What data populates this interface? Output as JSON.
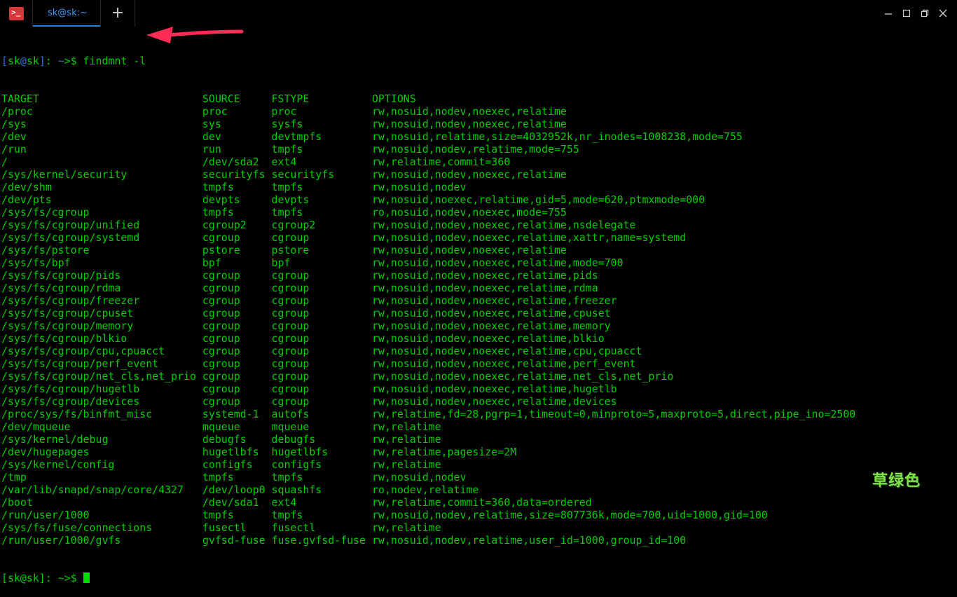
{
  "window": {
    "tab_title": "sk@sk:~",
    "new_tab_symbol": "+",
    "icons": {
      "app": "terminal-icon",
      "minimize": "minimize-icon",
      "maximize": "maximize-icon",
      "restore": "restore-icon",
      "close": "close-icon"
    }
  },
  "prompt": {
    "open_bracket": "[",
    "user": "sk",
    "at": "@",
    "host": "sk",
    "close_bracket": "]",
    "separator": ": ",
    "path": "~",
    "symbol": ">$ ",
    "command": "findmnt -l"
  },
  "final_prompt": {
    "text": "[sk@sk]: ~>$ "
  },
  "accent_colors": {
    "text": "#00cd00",
    "prompt_blue": "#2f6fd8",
    "arrow": "#ff2d55",
    "tab_active": "#3a9bff"
  },
  "table": {
    "headers": [
      "TARGET",
      "SOURCE",
      "FSTYPE",
      "OPTIONS"
    ],
    "rows": [
      [
        "/proc",
        "proc",
        "proc",
        "rw,nosuid,nodev,noexec,relatime"
      ],
      [
        "/sys",
        "sys",
        "sysfs",
        "rw,nosuid,nodev,noexec,relatime"
      ],
      [
        "/dev",
        "dev",
        "devtmpfs",
        "rw,nosuid,relatime,size=4032952k,nr_inodes=1008238,mode=755"
      ],
      [
        "/run",
        "run",
        "tmpfs",
        "rw,nosuid,nodev,relatime,mode=755"
      ],
      [
        "/",
        "/dev/sda2",
        "ext4",
        "rw,relatime,commit=360"
      ],
      [
        "/sys/kernel/security",
        "securityfs",
        "securityfs",
        "rw,nosuid,nodev,noexec,relatime"
      ],
      [
        "/dev/shm",
        "tmpfs",
        "tmpfs",
        "rw,nosuid,nodev"
      ],
      [
        "/dev/pts",
        "devpts",
        "devpts",
        "rw,nosuid,noexec,relatime,gid=5,mode=620,ptmxmode=000"
      ],
      [
        "/sys/fs/cgroup",
        "tmpfs",
        "tmpfs",
        "ro,nosuid,nodev,noexec,mode=755"
      ],
      [
        "/sys/fs/cgroup/unified",
        "cgroup2",
        "cgroup2",
        "rw,nosuid,nodev,noexec,relatime,nsdelegate"
      ],
      [
        "/sys/fs/cgroup/systemd",
        "cgroup",
        "cgroup",
        "rw,nosuid,nodev,noexec,relatime,xattr,name=systemd"
      ],
      [
        "/sys/fs/pstore",
        "pstore",
        "pstore",
        "rw,nosuid,nodev,noexec,relatime"
      ],
      [
        "/sys/fs/bpf",
        "bpf",
        "bpf",
        "rw,nosuid,nodev,noexec,relatime,mode=700"
      ],
      [
        "/sys/fs/cgroup/pids",
        "cgroup",
        "cgroup",
        "rw,nosuid,nodev,noexec,relatime,pids"
      ],
      [
        "/sys/fs/cgroup/rdma",
        "cgroup",
        "cgroup",
        "rw,nosuid,nodev,noexec,relatime,rdma"
      ],
      [
        "/sys/fs/cgroup/freezer",
        "cgroup",
        "cgroup",
        "rw,nosuid,nodev,noexec,relatime,freezer"
      ],
      [
        "/sys/fs/cgroup/cpuset",
        "cgroup",
        "cgroup",
        "rw,nosuid,nodev,noexec,relatime,cpuset"
      ],
      [
        "/sys/fs/cgroup/memory",
        "cgroup",
        "cgroup",
        "rw,nosuid,nodev,noexec,relatime,memory"
      ],
      [
        "/sys/fs/cgroup/blkio",
        "cgroup",
        "cgroup",
        "rw,nosuid,nodev,noexec,relatime,blkio"
      ],
      [
        "/sys/fs/cgroup/cpu,cpuacct",
        "cgroup",
        "cgroup",
        "rw,nosuid,nodev,noexec,relatime,cpu,cpuacct"
      ],
      [
        "/sys/fs/cgroup/perf_event",
        "cgroup",
        "cgroup",
        "rw,nosuid,nodev,noexec,relatime,perf_event"
      ],
      [
        "/sys/fs/cgroup/net_cls,net_prio",
        "cgroup",
        "cgroup",
        "rw,nosuid,nodev,noexec,relatime,net_cls,net_prio"
      ],
      [
        "/sys/fs/cgroup/hugetlb",
        "cgroup",
        "cgroup",
        "rw,nosuid,nodev,noexec,relatime,hugetlb"
      ],
      [
        "/sys/fs/cgroup/devices",
        "cgroup",
        "cgroup",
        "rw,nosuid,nodev,noexec,relatime,devices"
      ],
      [
        "/proc/sys/fs/binfmt_misc",
        "systemd-1",
        "autofs",
        "rw,relatime,fd=28,pgrp=1,timeout=0,minproto=5,maxproto=5,direct,pipe_ino=2500"
      ],
      [
        "/dev/mqueue",
        "mqueue",
        "mqueue",
        "rw,relatime"
      ],
      [
        "/sys/kernel/debug",
        "debugfs",
        "debugfs",
        "rw,relatime"
      ],
      [
        "/dev/hugepages",
        "hugetlbfs",
        "hugetlbfs",
        "rw,relatime,pagesize=2M"
      ],
      [
        "/sys/kernel/config",
        "configfs",
        "configfs",
        "rw,relatime"
      ],
      [
        "/tmp",
        "tmpfs",
        "tmpfs",
        "rw,nosuid,nodev"
      ],
      [
        "/var/lib/snapd/snap/core/4327",
        "/dev/loop0",
        "squashfs",
        "ro,nodev,relatime"
      ],
      [
        "/boot",
        "/dev/sda1",
        "ext4",
        "rw,relatime,commit=360,data=ordered"
      ],
      [
        "/run/user/1000",
        "tmpfs",
        "tmpfs",
        "rw,nosuid,nodev,relatime,size=807736k,mode=700,uid=1000,gid=100"
      ],
      [
        "/sys/fs/fuse/connections",
        "fusectl",
        "fusectl",
        "rw,relatime"
      ],
      [
        "/run/user/1000/gvfs",
        "gvfsd-fuse",
        "fuse.gvfsd-fuse",
        "rw,nosuid,nodev,relatime,user_id=1000,group_id=100"
      ]
    ]
  },
  "watermark": "草绿色"
}
